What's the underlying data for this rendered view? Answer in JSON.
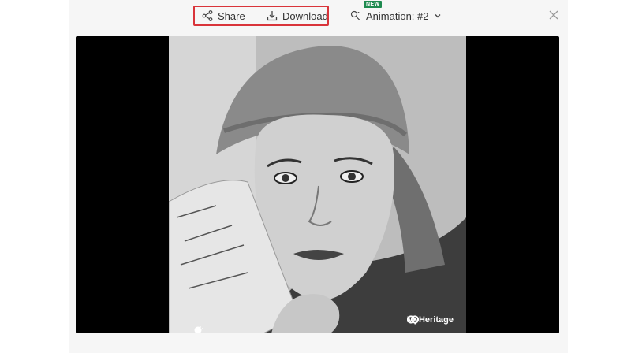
{
  "toolbar": {
    "share_label": "Share",
    "download_label": "Download",
    "new_badge": "NEW",
    "animation_label": "Animation: #2",
    "highlight_color": "#d9343a",
    "badge_color": "#1e8a4f"
  },
  "viewer": {
    "watermark": "MyHeritage",
    "icons": [
      "share-icon",
      "download-icon",
      "animation-icon",
      "chevron-down-icon",
      "close-icon",
      "magic-wand-icon",
      "face-icon",
      "myheritage-logo-icon"
    ]
  }
}
